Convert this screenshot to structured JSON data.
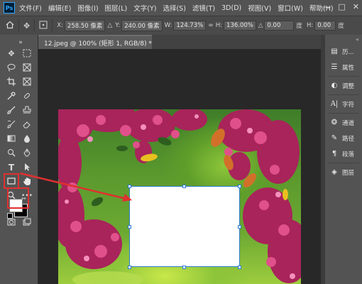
{
  "app": {
    "logo": "Ps"
  },
  "menu": [
    "文件(F)",
    "编辑(E)",
    "图像(I)",
    "图层(L)",
    "文字(Y)",
    "选择(S)",
    "滤镜(T)",
    "3D(D)",
    "视图(V)",
    "窗口(W)",
    "帮助(H)"
  ],
  "window_controls": [
    "—",
    "□",
    "✕"
  ],
  "options": {
    "x_label": "X:",
    "x_value": "258.50 像素",
    "y_label": "Y:",
    "y_value": "240.00 像素",
    "w_label": "W:",
    "w_value": "124.73%",
    "h_label": "H:",
    "h_value": "136.00%",
    "angle_label": "△",
    "angle_value": "0.00",
    "angle_unit": "度",
    "hskew_label": "H:",
    "hskew_value": "0.00",
    "hskew_unit": "度"
  },
  "document_tab": {
    "title": "12.jpeg @ 100% (矩形 1, RGB/8) *",
    "close": "×"
  },
  "panels": [
    {
      "icon": "history-icon",
      "label": "历..."
    },
    {
      "icon": "properties-icon",
      "label": "属性"
    },
    {
      "icon": "adjustments-icon",
      "label": "调整"
    },
    {
      "icon": "character-icon",
      "label": "字符"
    },
    {
      "icon": "channels-icon",
      "label": "通道"
    },
    {
      "icon": "paths-icon",
      "label": "路径"
    },
    {
      "icon": "paragraph-icon",
      "label": "段落"
    },
    {
      "icon": "layers-icon",
      "label": "图层"
    }
  ],
  "colors": {
    "highlight": "#e03030",
    "selection": "#2d7cd0",
    "foreground": "#ffffff",
    "background": "#000000"
  },
  "rectangle_tool_highlighted": true
}
